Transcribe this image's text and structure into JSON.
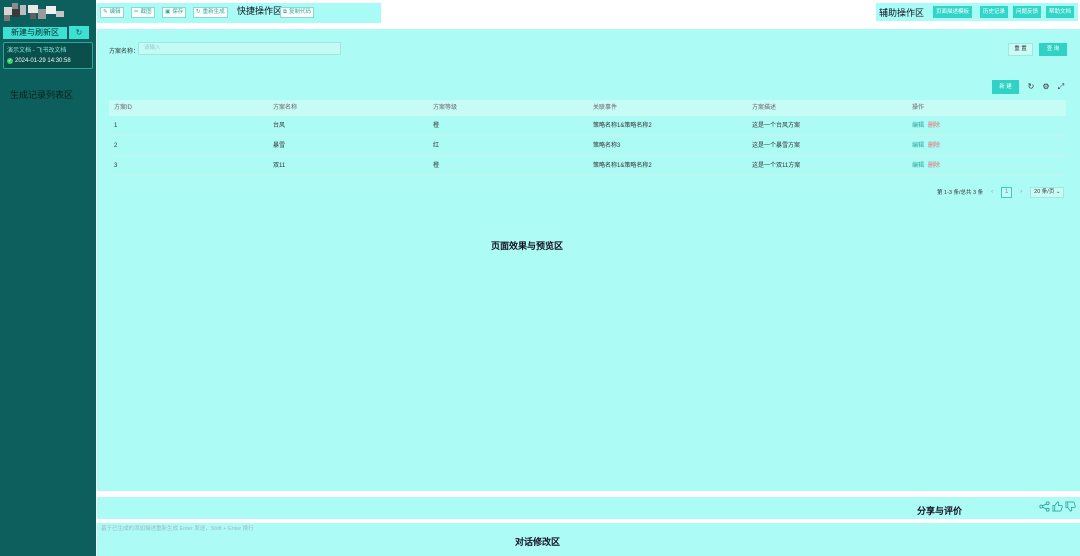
{
  "sidebar": {
    "new_refresh_label": "新建与刷新区",
    "refresh_icon": "refresh-icon",
    "doc": {
      "title": "演示文档 - 飞书改文档",
      "time": "2024-01-29 14:30:58"
    },
    "gen_list_label": "生成记录列表区"
  },
  "toolbar": {
    "edit": "编辑",
    "screenshot": "截图",
    "save": "保存",
    "regenerate": "重新生成",
    "copy_code": "复制代码",
    "label": "快捷操作区"
  },
  "aux": {
    "label": "辅助操作区",
    "page_desc": "页面描述模板",
    "history": "历史记录",
    "feedback": "问题反馈",
    "help": "帮助文档"
  },
  "preview": {
    "search_label": "方案名称：",
    "search_placeholder": "请输入",
    "reset": "重 置",
    "query": "查 询",
    "new": "新 建",
    "label": "页面效果与预览区",
    "table": {
      "headers": [
        "方案ID",
        "方案名称",
        "方案等级",
        "关联事件",
        "方案描述",
        "操作"
      ],
      "rows": [
        {
          "id": "1",
          "name": "台风",
          "level": "橙",
          "event": "策略名称1&策略名称2",
          "desc": "这是一个台风方案",
          "edit": "编辑",
          "del": "删除"
        },
        {
          "id": "2",
          "name": "暴雪",
          "level": "红",
          "event": "策略名称3",
          "desc": "这是一个暴雪方案",
          "edit": "编辑",
          "del": "删除"
        },
        {
          "id": "3",
          "name": "双11",
          "level": "橙",
          "event": "策略名称1&策略名称2",
          "desc": "这是一个双11方案",
          "edit": "编辑",
          "del": "删除"
        }
      ]
    },
    "pager": {
      "summary": "第 1-3 条/总共 3 条",
      "prev": "‹",
      "current": "1",
      "next": "›",
      "page_size": "20 条/页 ⌄"
    }
  },
  "share": {
    "label": "分享与评价"
  },
  "chat": {
    "placeholder": "基于已生成的添加描述重新生成 Enter 发送，Shift + Enter 换行",
    "label": "对话修改区"
  },
  "colors": {
    "sidebar": "#0c5f5c",
    "accent": "#2fd2c4",
    "region": "#adfbf5"
  }
}
